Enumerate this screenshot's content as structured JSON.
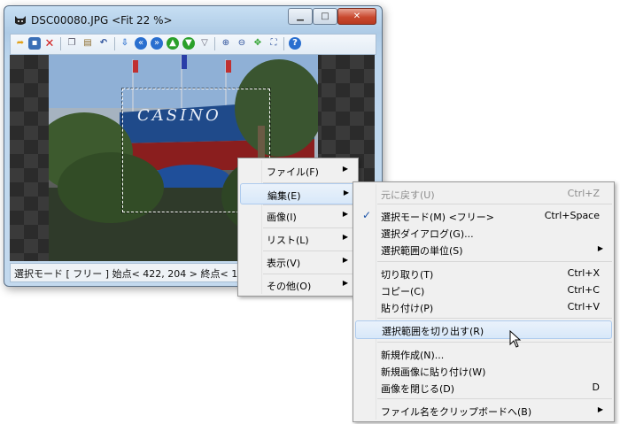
{
  "window": {
    "title": "DSC00080.JPG <Fit 22 %>"
  },
  "toolbar": {
    "icons": [
      "open-icon",
      "save-icon",
      "delete-icon",
      "copy-icon",
      "paste-icon",
      "undo-icon",
      "info-icon",
      "first-icon",
      "last-icon",
      "prev-icon",
      "next-icon",
      "slideshow-icon",
      "zoom-in-icon",
      "zoom-out-icon",
      "fit-icon",
      "fullscreen-icon",
      "help-icon"
    ]
  },
  "status": {
    "text": "選択モード [ フリー ] 始点< 422, 204 >  終点< 1154, 816 >"
  },
  "main_menu": {
    "items": [
      {
        "label": "ファイル(F)",
        "submenu": true
      },
      {
        "label": "編集(E)",
        "submenu": true,
        "highlighted": true
      },
      {
        "label": "画像(I)",
        "submenu": true
      },
      {
        "label": "リスト(L)",
        "submenu": true
      },
      {
        "label": "表示(V)",
        "submenu": true
      },
      {
        "label": "その他(O)",
        "submenu": true
      }
    ],
    "arrow": "▶"
  },
  "edit_menu": {
    "check_mark": "✓",
    "arrow": "▶",
    "items": [
      {
        "label": "元に戻す(U)",
        "shortcut": "Ctrl+Z",
        "disabled": true
      },
      {
        "label": "選択モード(M) <フリー>",
        "shortcut": "Ctrl+Space",
        "checked": true
      },
      {
        "label": "選択ダイアログ(G)...",
        "shortcut": ""
      },
      {
        "label": "選択範囲の単位(S)",
        "shortcut": "",
        "submenu": true
      },
      {
        "label": "切り取り(T)",
        "shortcut": "Ctrl+X"
      },
      {
        "label": "コピー(C)",
        "shortcut": "Ctrl+C"
      },
      {
        "label": "貼り付け(P)",
        "shortcut": "Ctrl+V"
      },
      {
        "label": "選択範囲を切り出す(R)",
        "shortcut": "",
        "highlighted": true
      },
      {
        "label": "新規作成(N)...",
        "shortcut": ""
      },
      {
        "label": "新規画像に貼り付け(W)",
        "shortcut": ""
      },
      {
        "label": "画像を閉じる(D)",
        "shortcut": "D"
      },
      {
        "label": "ファイル名をクリップボードへ(B)",
        "shortcut": "",
        "submenu": true
      }
    ]
  },
  "photo": {
    "sign_text": "CASINO"
  },
  "colors": {
    "menu_highlight": "#d8e8f9",
    "toolbar_blue": "#2a6fcf",
    "close_red": "#c9492f"
  }
}
